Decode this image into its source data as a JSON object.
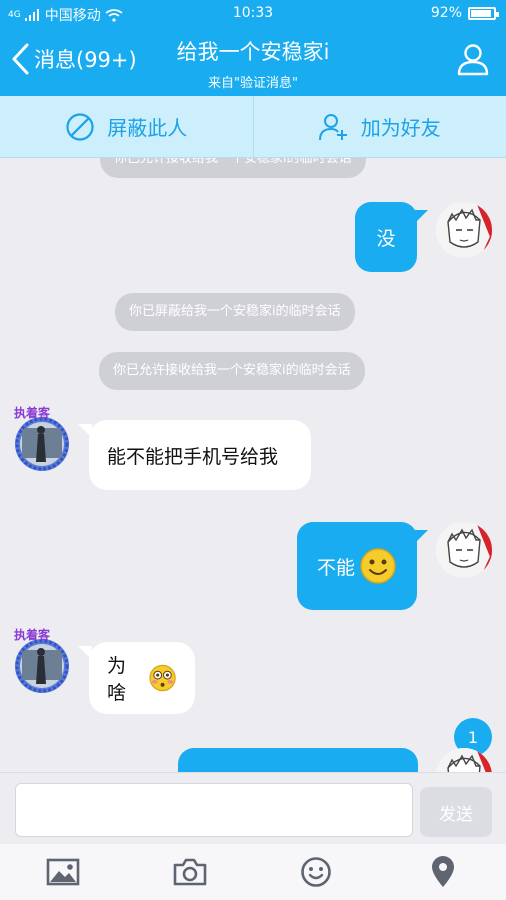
{
  "status": {
    "carrier": "中国移动",
    "signal": "4G",
    "time": "10:33",
    "battery": "92%",
    "battery_level": 0.92
  },
  "header": {
    "back_label": "消息(99+)",
    "title": "给我一个安稳家i",
    "subtitle": "来自\"验证消息\""
  },
  "actions": {
    "block_label": "屏蔽此人",
    "add_friend_label": "加为好友"
  },
  "messages": {
    "sys_partial": "你已允许接收给我一个安稳家i的临时会话",
    "me_1": "没",
    "sys_1": "你已屏蔽给我一个安稳家i的临时会话",
    "sys_2": "你已允许接收给我一个安稳家i的临时会话",
    "other_1": "能不能把手机号给我",
    "me_2": "不能",
    "other_2": "为啥",
    "unread_count": "1"
  },
  "other_avatar_badge": "执着客",
  "composer": {
    "input_value": "",
    "send_label": "发送"
  },
  "colors": {
    "accent": "#1aacf0",
    "system_bubble": "#cfcfd6",
    "action_bar": "#cdeefb"
  },
  "toolbar_icons": [
    "image-icon",
    "camera-icon",
    "emoji-icon",
    "location-icon"
  ]
}
